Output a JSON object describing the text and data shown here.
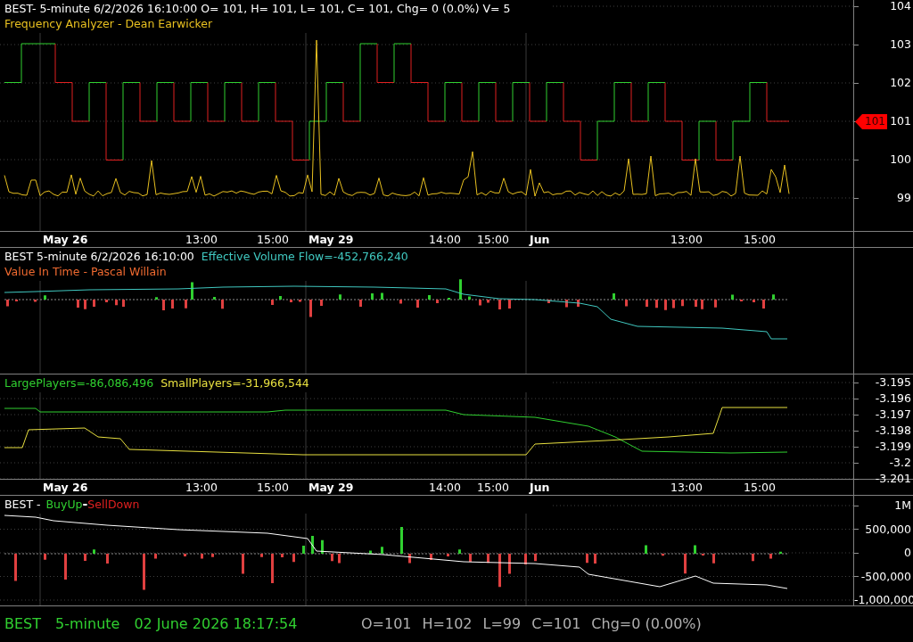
{
  "panes": [
    {
      "kind": "price",
      "lines": [
        [
          {
            "text": "BEST- 5-minute 6/2/2026 16:10:00 O= 101, H= 101, L= 101, C= 101, Chg= 0 (0.0%) V= 5",
            "color": "#ffffff"
          }
        ],
        [
          {
            "text": "Frequency Analyzer - Dean Earwicker",
            "color": "#e8c020"
          }
        ]
      ],
      "y_ticks": [
        "104",
        "103",
        "102",
        "101",
        "100",
        "99"
      ],
      "price_flag": "101",
      "date_axis": [
        {
          "label": "May 26",
          "bold": true
        },
        {
          "label": "13:00",
          "bold": false
        },
        {
          "label": "15:00",
          "bold": false
        },
        {
          "label": "May 29",
          "bold": true
        },
        {
          "label": "14:00",
          "bold": false
        },
        {
          "label": "15:00",
          "bold": false
        },
        {
          "label": "Jun",
          "bold": true
        },
        {
          "label": "13:00",
          "bold": false
        },
        {
          "label": "15:00",
          "bold": false
        }
      ]
    },
    {
      "kind": "flow",
      "lines": [
        [
          {
            "text": "BEST 5-minute  6/2/2026 16:10:00",
            "color": "#ffffff"
          },
          {
            "text": "Effective Volume Flow=-452,766,240",
            "color": "#40c8c0"
          }
        ],
        [
          {
            "text": "Value In Time - Pascal Willain",
            "color": "#f06a30"
          }
        ]
      ]
    },
    {
      "kind": "players",
      "lines": [
        [
          {
            "text": "LargePlayers=-86,086,496",
            "color": "#30d030"
          },
          {
            "text": "SmallPlayers=-31,966,544",
            "color": "#e8e040"
          }
        ]
      ],
      "y_ticks": [
        "-3.195",
        "-3.196",
        "-3.197",
        "-3.198",
        "-3.199",
        "-3.2",
        "-3.201"
      ],
      "date_axis": [
        {
          "label": "May 26",
          "bold": true
        },
        {
          "label": "13:00",
          "bold": false
        },
        {
          "label": "15:00",
          "bold": false
        },
        {
          "label": "May 29",
          "bold": true
        },
        {
          "label": "14:00",
          "bold": false
        },
        {
          "label": "15:00",
          "bold": false
        },
        {
          "label": "Jun",
          "bold": true
        },
        {
          "label": "13:00",
          "bold": false
        },
        {
          "label": "15:00",
          "bold": false
        }
      ]
    },
    {
      "kind": "buyup",
      "lines": [
        [
          {
            "text": "BEST -",
            "color": "#ffffff"
          },
          {
            "text": "BuyUp",
            "color": "#30d030"
          },
          {
            "text": "-",
            "color": "#ffffff"
          },
          {
            "text": "SellDown",
            "color": "#e02020"
          }
        ]
      ],
      "y_ticks": [
        "1M",
        "500,000",
        "0",
        "-500,000",
        "-1,000,000"
      ]
    }
  ],
  "status_bar": {
    "left": [
      {
        "text": "BEST",
        "color": "#30d030"
      },
      {
        "text": "5-minute",
        "color": "#30d030"
      },
      {
        "text": "02 June 2026 18:17:54",
        "color": "#30d030"
      }
    ],
    "right": [
      {
        "text": "O=101",
        "color": "#b0b0b0"
      },
      {
        "text": "H=102",
        "color": "#b0b0b0"
      },
      {
        "text": "L=99",
        "color": "#b0b0b0"
      },
      {
        "text": "C=101",
        "color": "#b0b0b0"
      },
      {
        "text": "Chg=0 (0.00%)",
        "color": "#b0b0b0"
      }
    ]
  }
}
